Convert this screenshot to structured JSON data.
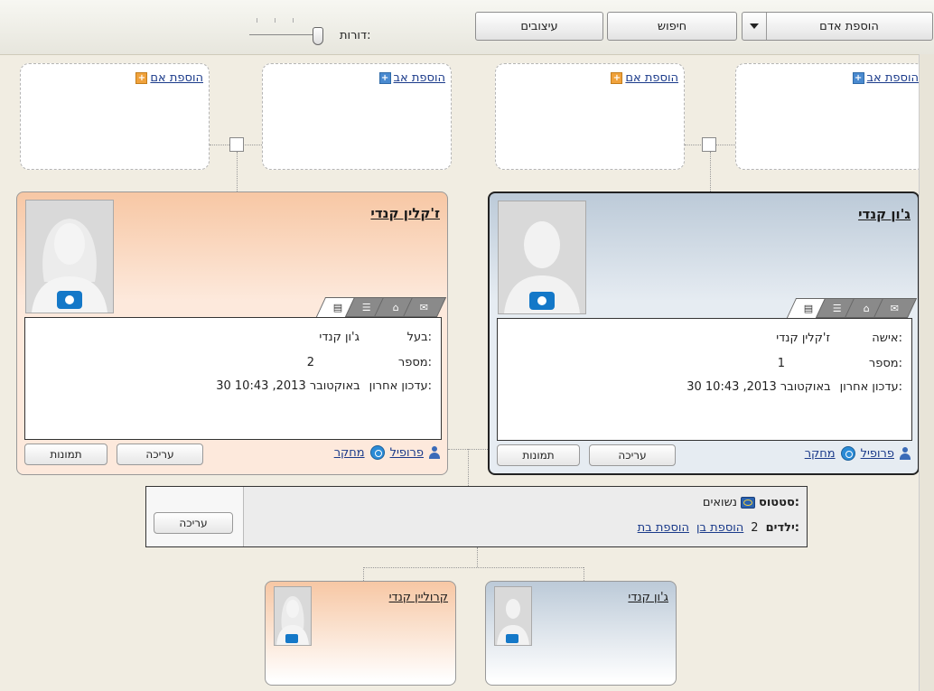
{
  "toolbar": {
    "add_person": "הוספת אדם",
    "search": "חיפוש",
    "styles": "עיצובים",
    "generations_label": "דורות:"
  },
  "parents": [
    {
      "label": "הוספת אב",
      "icon": "plus-blue-icon"
    },
    {
      "label": "הוספת אם",
      "icon": "plus-orange-icon"
    },
    {
      "label": "הוספת אב",
      "icon": "plus-blue-icon"
    },
    {
      "label": "הוספת אם",
      "icon": "plus-orange-icon"
    }
  ],
  "male_card": {
    "name": "ג'ון קנדי",
    "spouse_label": "אישה:",
    "spouse_value": "ז'קלין קנדי",
    "number_label": "מספר:",
    "number_value": "1",
    "updated_label": "עדכון אחרון:",
    "updated_value": "30 באוקטובר 2013, 10:43",
    "profile": "פרופיל",
    "research": "מחקר",
    "edit": "עריכה",
    "photos": "תמונות"
  },
  "female_card": {
    "name": "ז'קלין קנדי",
    "spouse_label": "בעל:",
    "spouse_value": "ג'ון קנדי",
    "number_label": "מספר:",
    "number_value": "2",
    "updated_label": "עדכון אחרון:",
    "updated_value": "30 באוקטובר 2013, 10:43",
    "profile": "פרופיל",
    "research": "מחקר",
    "edit": "עריכה",
    "photos": "תמונות"
  },
  "family": {
    "status_label": "סטטוס:",
    "status_value": "נשואים",
    "children_label": "ילדים:",
    "children_count": "2",
    "add_son": "הוספת בן",
    "add_daughter": "הוספת בת",
    "edit": "עריכה"
  },
  "children": [
    {
      "name": "ג'ון קנדי"
    },
    {
      "name": "קרוליין קנדי"
    }
  ]
}
